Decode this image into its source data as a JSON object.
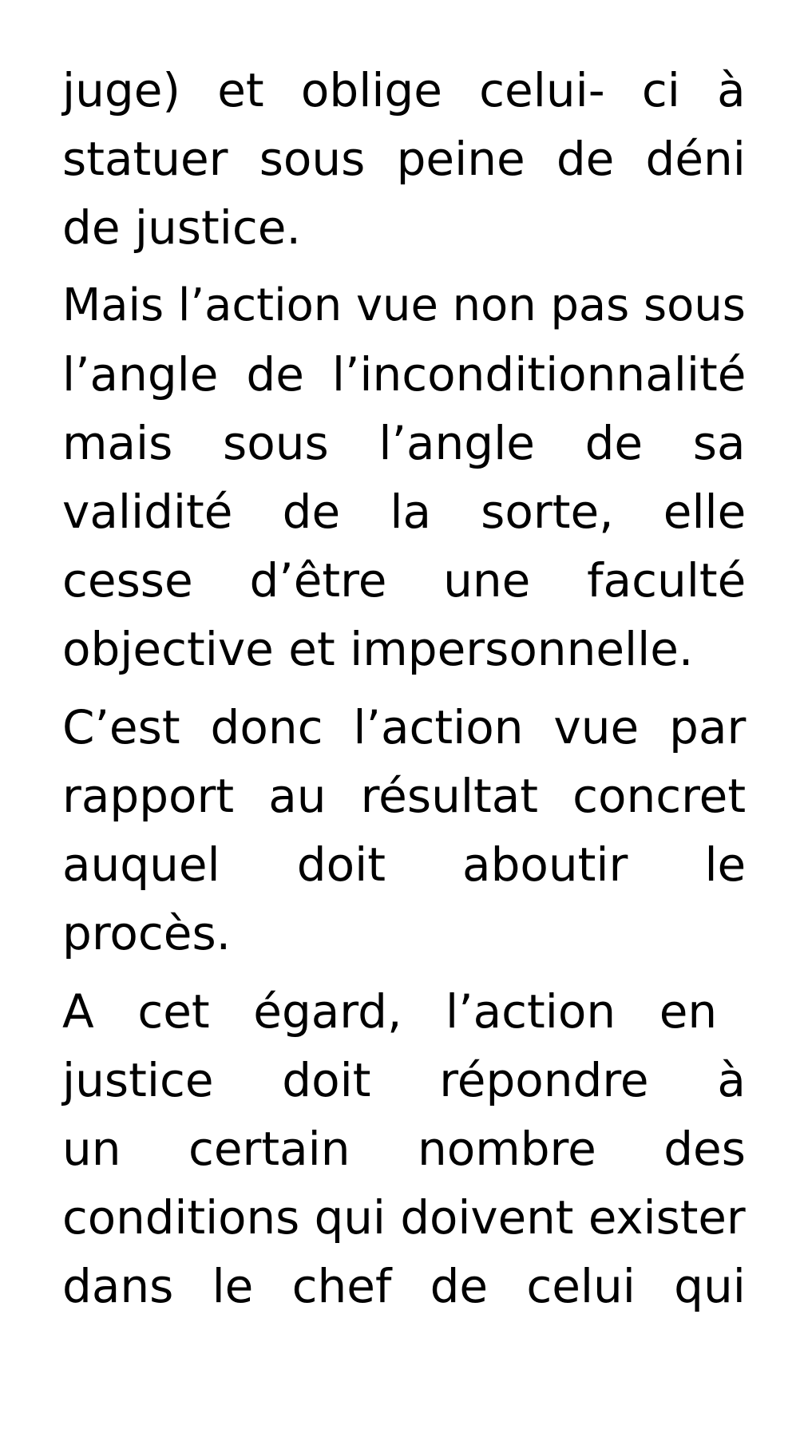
{
  "document": {
    "paragraphs": [
      {
        "lines": [
          {
            "text": "juge) et oblige celui- ci à",
            "justify": true
          },
          {
            "text": "statuer sous peine de déni",
            "justify": true
          },
          {
            "text": "de justice.",
            "justify": false
          }
        ]
      },
      {
        "lines": [
          {
            "text": "Mais l’action vue non pas sous",
            "justify": true
          },
          {
            "text": "l’angle de l’inconditionnalité",
            "justify": true
          },
          {
            "text": "mais sous l’angle de sa",
            "justify": true
          },
          {
            "text": "validité de la sorte, elle",
            "justify": true
          },
          {
            "text": "cesse d’être une faculté",
            "justify": true
          },
          {
            "text": "objective et impersonnelle.",
            "justify": false
          }
        ]
      },
      {
        "lines": [
          {
            "text": "C’est donc l’action vue par",
            "justify": true
          },
          {
            "text": "rapport au résultat concret",
            "justify": true
          },
          {
            "text": "auquel doit aboutir le",
            "justify": true
          },
          {
            "text": "procès.",
            "justify": false
          }
        ]
      },
      {
        "lines": [
          {
            "text": "A cet  égard, l’action en",
            "justify": true
          },
          {
            "text": "justice doit répondre à",
            "justify": true
          },
          {
            "text": "un certain nombre des",
            "justify": true
          },
          {
            "text": "conditions qui doivent exister",
            "justify": true
          },
          {
            "text": "dans le chef de celui qui",
            "justify": true
          }
        ]
      }
    ]
  }
}
